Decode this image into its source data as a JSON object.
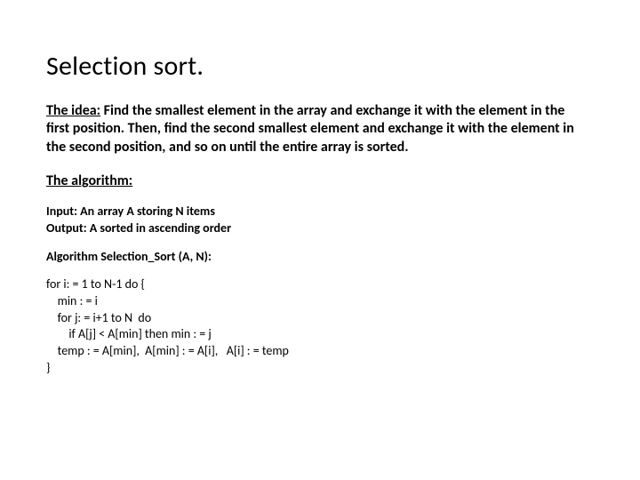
{
  "title": "Selection sort.",
  "idea": {
    "label": "The idea:",
    "text": " Find the smallest element in the array and exchange it with the element in the first position. Then, find the second smallest element and exchange it with the element in the second position, and so on until the entire array is sorted."
  },
  "algorithm": {
    "label": "The algorithm:",
    "input": "Input: An array A storing N items",
    "output": "Output: A sorted in ascending order",
    "name": "Algorithm Selection_Sort (A, N):",
    "code": "for i: = 1 to N-1 do {\n    min : = i\n    for j: = i+1 to N  do\n        if A[j] < A[min] then min : = j\n    temp : = A[min],  A[min] : = A[i],   A[i] : = temp\n}"
  }
}
